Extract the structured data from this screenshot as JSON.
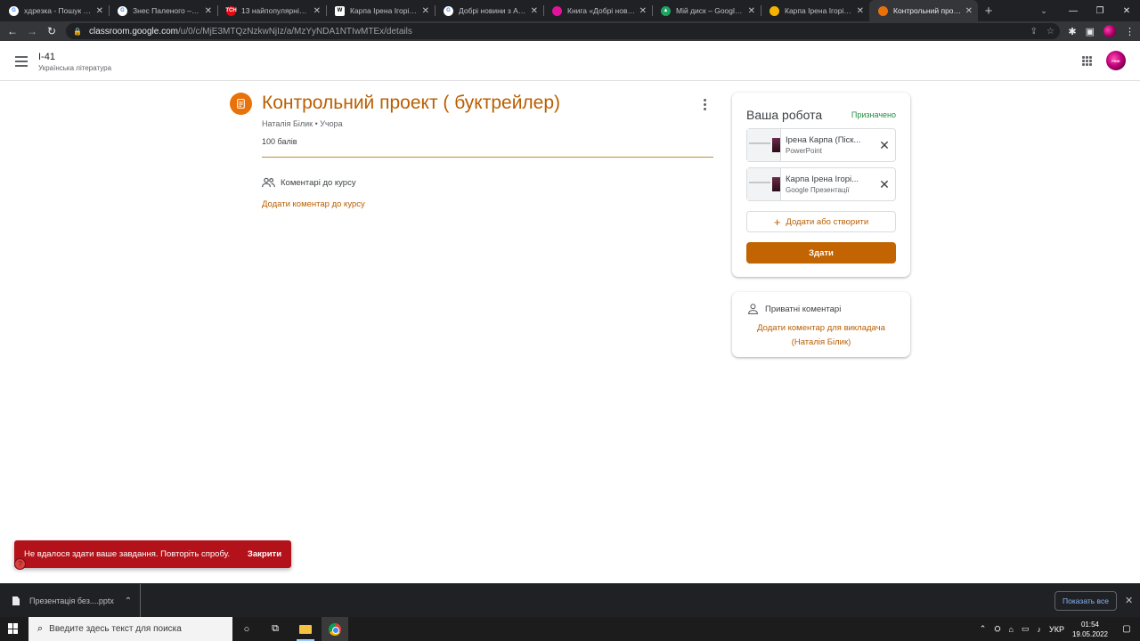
{
  "browser": {
    "tabs": [
      {
        "title": "хдрезка - Пошук Goo",
        "icon": "google-icon",
        "color": "#ffffff",
        "glyph": "G"
      },
      {
        "title": "Знес Паленого – Пош",
        "icon": "google-icon",
        "color": "#ffffff",
        "glyph": "G"
      },
      {
        "title": "13 найпопулярніших",
        "icon": "tsn-icon",
        "color": "#e50914",
        "glyph": "ТСН"
      },
      {
        "title": "Карпа Ірена Ігорівна",
        "icon": "wikipedia-icon",
        "color": "#ffffff",
        "glyph": "W"
      },
      {
        "title": "Добрі новини з Арал",
        "icon": "google-icon",
        "color": "#ffffff",
        "glyph": "G"
      },
      {
        "title": "Книга «Добрі новини",
        "icon": "book-site-icon",
        "color": "#e0149a",
        "glyph": ""
      },
      {
        "title": "Мій диск – Google Ди",
        "icon": "google-drive-icon",
        "color": "#1fa463",
        "glyph": "▲"
      },
      {
        "title": "Карпа Ірена Ігорівна",
        "icon": "google-slides-icon",
        "color": "#f4b400",
        "glyph": ""
      },
      {
        "title": "Контрольний проект",
        "icon": "classroom-icon",
        "color": "#e8710a",
        "glyph": "",
        "active": true
      }
    ],
    "url_domain": "classroom.google.com",
    "url_path": "/u/0/c/MjE3MTQzNzkwNjIz/a/MzYyNDA1NTIwMTEx/details"
  },
  "header": {
    "class_name": "І-41",
    "subject": "Українська література"
  },
  "assignment": {
    "title": "Контрольний проект ( буктрейлер)",
    "meta": "Наталія Білик • Учора",
    "points": "100 балів",
    "course_comments_label": "Коментарі до курсу",
    "add_course_comment": "Додати коментар до курсу",
    "accent_color": "#b95e00"
  },
  "your_work": {
    "title": "Ваша робота",
    "status": "Призначено",
    "status_color": "#1e8e3e",
    "attachments": [
      {
        "name": "Ірена Карпа (Піск...",
        "type": "PowerPoint"
      },
      {
        "name": "Карпа Ірена Ігорі...",
        "type": "Google Презентації"
      }
    ],
    "add_create": "Додати або створити",
    "submit": "Здати"
  },
  "private_comments": {
    "label": "Приватні коментарі",
    "add_line1": "Додати коментар для викладача",
    "add_line2": "(Наталія Білик)"
  },
  "snackbar": {
    "message": "Не вдалося здати ваше завдання. Повторіть спробу.",
    "close": "Закрити",
    "color": "#b3121a"
  },
  "downloads": {
    "file": "Презентація без....pptx",
    "show_all": "Показать все"
  },
  "taskbar": {
    "search_placeholder": "Введите здесь текст для поиска",
    "lang": "УКР",
    "time": "01:54",
    "date": "19.05.2022"
  }
}
